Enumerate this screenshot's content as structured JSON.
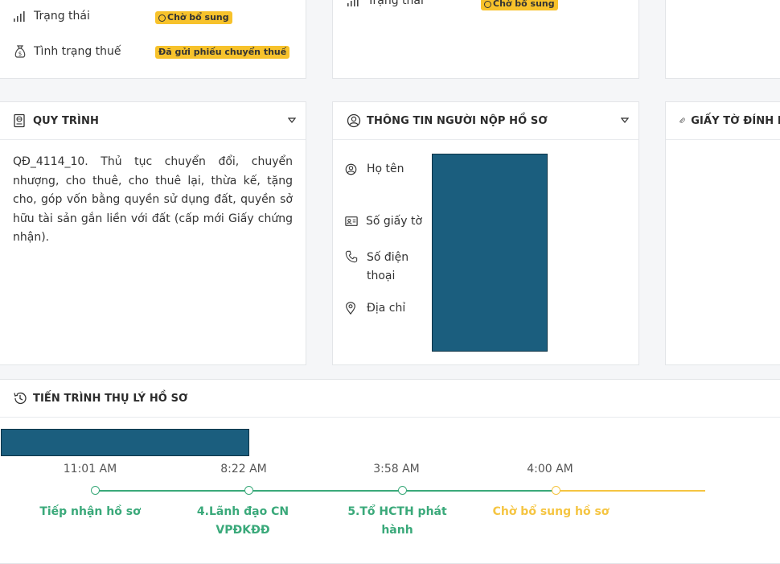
{
  "status_card": {
    "status_label": "Trạng thái",
    "status_badge": "Chờ bổ sung",
    "tax_label": "Tình trạng thuế",
    "tax_badge": "Đã gửi phiếu chuyển thuế"
  },
  "status_card_2": {
    "status_label": "Trạng thái",
    "status_badge": "Chờ bổ sung"
  },
  "procedure_card": {
    "title": "QUY TRÌNH",
    "body": "QĐ_4114_10. Thủ tục chuyển đổi, chuyển nhượng, cho thuê, cho thuê lại, thừa kế, tặng cho, góp vốn bằng quyền sử dụng đất, quyền sở hữu tài sản gắn liền với đất (cấp mới Giấy chứng nhận)."
  },
  "applicant_card": {
    "title": "THÔNG TIN NGƯỜI NỘP HỒ SƠ",
    "fields": [
      {
        "label": "Họ tên",
        "icon": "user-circle-icon"
      },
      {
        "label": "Số giấy tờ",
        "icon": "id-card-icon"
      },
      {
        "label": "Số điện thoại",
        "icon": "phone-icon"
      },
      {
        "label": "Địa chỉ",
        "icon": "map-pin-icon"
      }
    ]
  },
  "attachments_card": {
    "title": "GIẤY TỜ ĐÍNH KÈ"
  },
  "progress_card": {
    "title": "TIẾN TRÌNH THỤ LÝ HỒ SƠ",
    "steps": [
      {
        "time": "11:01 AM",
        "label": "Tiếp nhận hồ sơ",
        "state": "done"
      },
      {
        "time": "8:22 AM",
        "label": "4.Lãnh đạo CN VPĐKĐĐ",
        "state": "done"
      },
      {
        "time": "3:58 AM",
        "label": "5.Tổ HCTH phát hành",
        "state": "done"
      },
      {
        "time": "4:00 AM",
        "label": "Chờ bổ sung hồ sơ",
        "state": "pending"
      }
    ]
  },
  "colors": {
    "accent_green": "#3aa97a",
    "pending_yellow": "#f5c542",
    "badge_yellow": "#f7c22b",
    "redaction": "#1b5e7e"
  }
}
